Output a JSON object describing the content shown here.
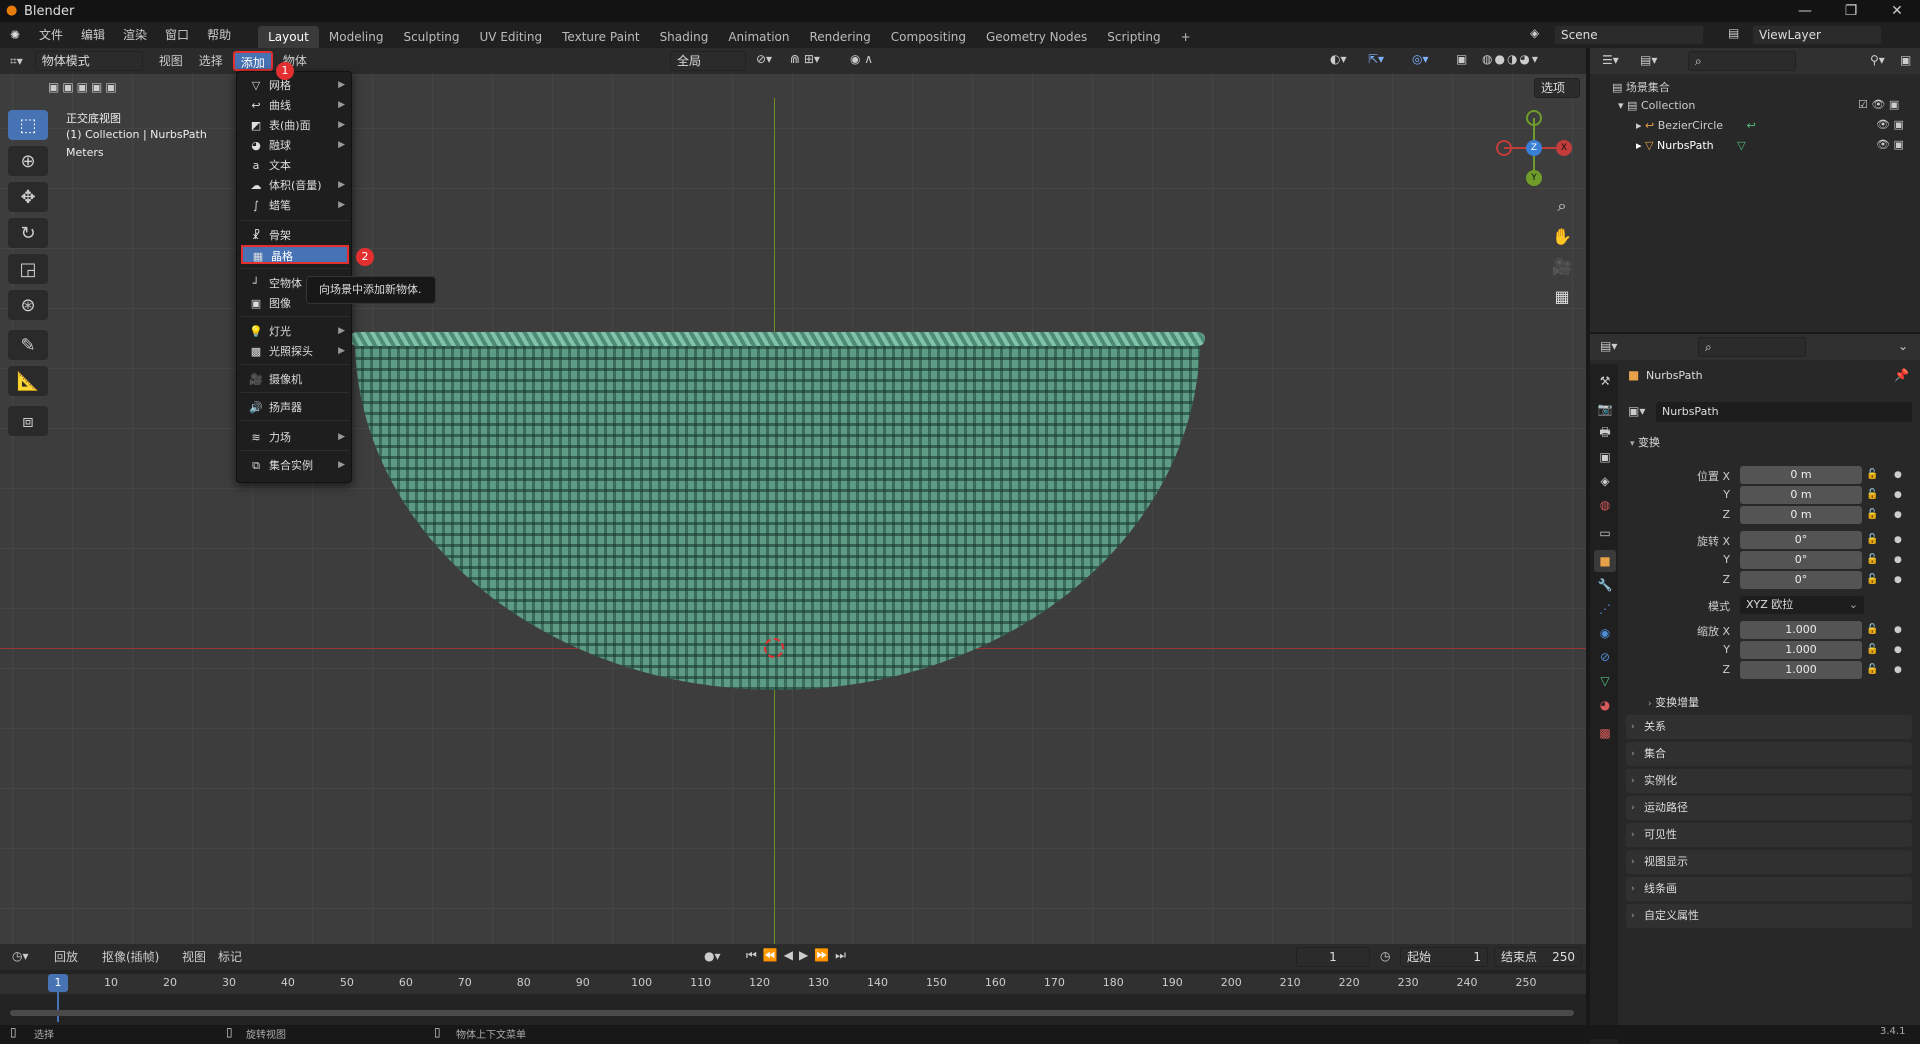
{
  "app": {
    "title": "Blender"
  },
  "menus": [
    "文件",
    "编辑",
    "渲染",
    "窗口",
    "帮助"
  ],
  "workspaces": [
    "Layout",
    "Modeling",
    "Sculpting",
    "UV Editing",
    "Texture Paint",
    "Shading",
    "Animation",
    "Rendering",
    "Compositing",
    "Geometry Nodes",
    "Scripting",
    "+"
  ],
  "scene": {
    "name": "Scene",
    "view_layer": "ViewLayer"
  },
  "viewport": {
    "mode": "物体模式",
    "header_menus": [
      "视图",
      "选择",
      "添加",
      "物体"
    ],
    "transform_orientation": "全局",
    "options_label": "选项",
    "overlay_lines": [
      "正交底视图",
      "(1) Collection | NurbsPath",
      "Meters"
    ],
    "gizmo": {
      "x": "X",
      "y": "Y",
      "z": "Z"
    }
  },
  "add_menu": {
    "items": [
      {
        "label": "网格",
        "icon": "mesh-icon",
        "submenu": true
      },
      {
        "label": "曲线",
        "icon": "curve-icon",
        "submenu": true
      },
      {
        "label": "表(曲)面",
        "icon": "surface-icon",
        "submenu": true
      },
      {
        "label": "融球",
        "icon": "metaball-icon",
        "submenu": true
      },
      {
        "label": "文本",
        "icon": "text-icon",
        "submenu": false
      },
      {
        "label": "体积(音量)",
        "icon": "volume-icon",
        "submenu": true
      },
      {
        "label": "蜡笔",
        "icon": "grease-pencil-icon",
        "submenu": true
      },
      {
        "label": "骨架",
        "icon": "armature-icon",
        "submenu": false
      },
      {
        "label": "晶格",
        "icon": "lattice-icon",
        "submenu": false
      },
      {
        "label": "空物体",
        "icon": "empty-icon",
        "submenu": true
      },
      {
        "label": "图像",
        "icon": "image-icon",
        "submenu": true
      },
      {
        "label": "灯光",
        "icon": "light-icon",
        "submenu": true
      },
      {
        "label": "光照探头",
        "icon": "light-probe-icon",
        "submenu": true
      },
      {
        "label": "摄像机",
        "icon": "camera-icon",
        "submenu": false
      },
      {
        "label": "扬声器",
        "icon": "speaker-icon",
        "submenu": false
      },
      {
        "label": "力场",
        "icon": "force-field-icon",
        "submenu": true
      },
      {
        "label": "集合实例",
        "icon": "collection-instance-icon",
        "submenu": true
      }
    ],
    "tooltip": "向场景中添加新物体.",
    "badges": [
      "1",
      "2"
    ]
  },
  "outliner": {
    "root": "场景集合",
    "collection": "Collection",
    "objects": [
      "BezierCircle",
      "NurbsPath"
    ]
  },
  "properties": {
    "object_name": "NurbsPath",
    "datablock": "NurbsPath",
    "transform_header": "变换",
    "location_label": "位置 X",
    "rotation_label": "旋转 X",
    "scale_label": "缩放 X",
    "y_label": "Y",
    "z_label": "Z",
    "mode_label": "模式",
    "mode_value": "XYZ 欧拉",
    "location": [
      "0 m",
      "0 m",
      "0 m"
    ],
    "rotation": [
      "0°",
      "0°",
      "0°"
    ],
    "scale": [
      "1.000",
      "1.000",
      "1.000"
    ],
    "delta_transform": "变换增量",
    "sections": [
      "关系",
      "集合",
      "实例化",
      "运动路径",
      "可见性",
      "视图显示",
      "线条画",
      "自定义属性"
    ]
  },
  "timeline": {
    "menus": [
      "回放",
      "抠像(插帧)",
      "视图",
      "标记"
    ],
    "current_frame": "1",
    "start_label": "起始",
    "start": "1",
    "end_label": "结束点",
    "end": "250",
    "ticks": [
      "1",
      "10",
      "20",
      "30",
      "40",
      "50",
      "60",
      "70",
      "80",
      "90",
      "100",
      "110",
      "120",
      "130",
      "140",
      "150",
      "160",
      "170",
      "180",
      "190",
      "200",
      "210",
      "220",
      "230",
      "240",
      "250"
    ]
  },
  "statusbar": {
    "select": "选择",
    "rotate": "旋转视图",
    "context_menu": "物体上下文菜单",
    "version": "3.4.1"
  }
}
